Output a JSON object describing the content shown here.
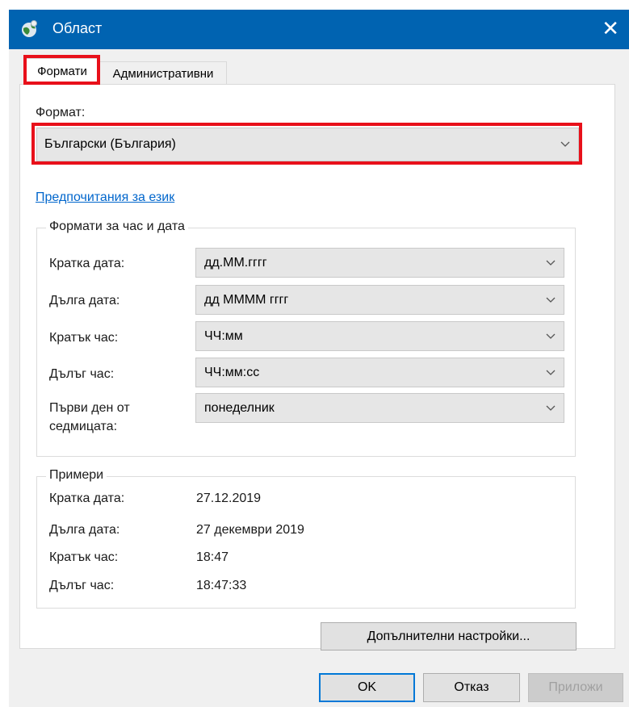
{
  "window": {
    "title": "Област",
    "close_glyph": "✕"
  },
  "tabs": [
    {
      "label": "Формати",
      "selected": true
    },
    {
      "label": "Административни",
      "selected": false
    }
  ],
  "format": {
    "label": "Формат:",
    "value": "Български (България)"
  },
  "language_link": "Предпочитания за език",
  "datetime_group": {
    "title": "Формати за час и дата",
    "rows": [
      {
        "label": "Кратка дата:",
        "value": "дд.ММ.гггг"
      },
      {
        "label": "Дълга дата:",
        "value": "дд ММММ гггг"
      },
      {
        "label": "Кратък час:",
        "value": "ЧЧ:мм"
      },
      {
        "label": "Дълъг час:",
        "value": "ЧЧ:мм:сс"
      },
      {
        "label_line1": "Първи ден от",
        "label_line2": "седмицата:",
        "value": "понеделник"
      }
    ]
  },
  "examples_group": {
    "title": "Примери",
    "rows": [
      {
        "label": "Кратка дата:",
        "value": "27.12.2019"
      },
      {
        "label": "Дълга дата:",
        "value": "27 декември 2019"
      },
      {
        "label": "Кратък час:",
        "value": "18:47"
      },
      {
        "label": "Дълъг час:",
        "value": "18:47:33"
      }
    ]
  },
  "buttons": {
    "additional": "Допълнителни настройки...",
    "ok": "OK",
    "cancel": "Отказ",
    "apply": "Приложи"
  },
  "colors": {
    "titlebar": "#0063b1",
    "highlight": "#e8101a",
    "link": "#0066cc"
  },
  "icons": [
    "globe-icon",
    "close-icon",
    "chevron-down-icon"
  ]
}
